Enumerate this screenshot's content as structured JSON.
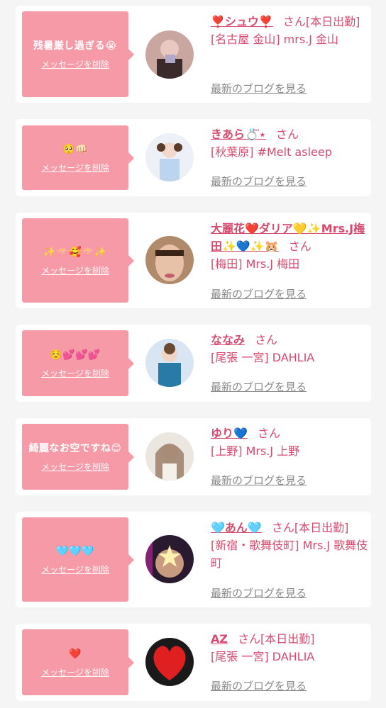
{
  "delete_label": "メッセージを削除",
  "blog_label": "最新のブログを見る",
  "honorific": "さん",
  "entries": [
    {
      "message": "残暑厳し過ぎる😭",
      "name": "❣️シュウ❣️",
      "badge": "[本日出勤]",
      "shop": "[名古屋 金山] mrs.J 金山"
    },
    {
      "message": "🥺👊🏻",
      "name": "きあら💍⃛⋆",
      "badge": "",
      "shop": "[秋葉原] #Melt asleep"
    },
    {
      "message": "✨🪷🥰🪷✨",
      "name": "大麗花❤️ダリア💛✨Mrs.J梅田✨💙✨🐹",
      "badge": "",
      "shop": "[梅田] Mrs.J 梅田"
    },
    {
      "message": "☺️💕💕💕",
      "name": "ななみ",
      "badge": "",
      "shop": "[尾張 一宮] DAHLIA"
    },
    {
      "message": "綺麗なお空ですね😊",
      "name": "ゆり💙",
      "badge": "",
      "shop": "[上野] Mrs.J 上野"
    },
    {
      "message": "🩵🩵🩵",
      "name": "🩵あん🩵",
      "badge": "[本日出勤]",
      "shop": "[新宿・歌舞伎町] Mrs.J 歌舞伎町"
    },
    {
      "message": "❤️",
      "name": "AZ",
      "badge": "[本日出勤]",
      "shop": "[尾張 一宮] DAHLIA"
    }
  ],
  "colors": {
    "accent": "#d84a6d",
    "bubble": "#f79aa8",
    "muted": "#888888",
    "background": "#f5f5f5"
  }
}
